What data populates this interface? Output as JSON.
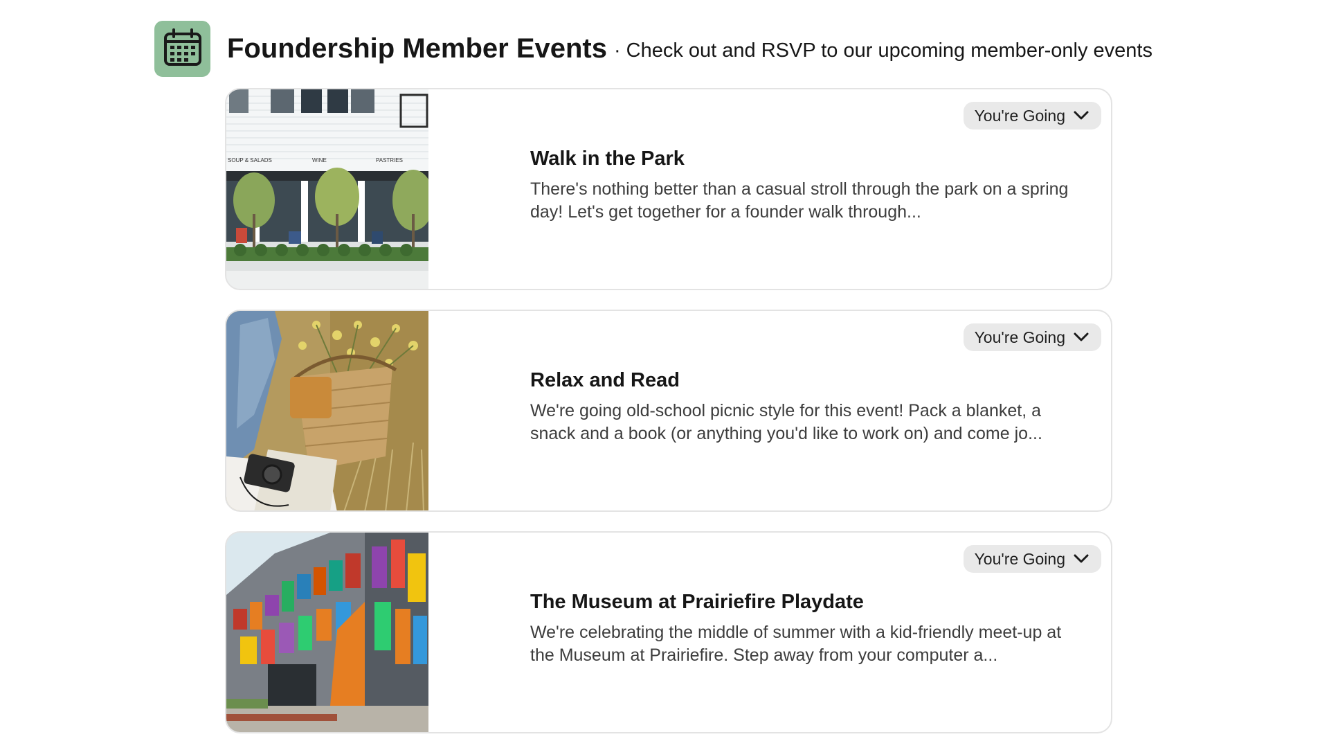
{
  "header": {
    "icon": "calendar-icon",
    "title": "Foundership Member Events",
    "separator": "·",
    "subtitle": "Check out and RSVP to our upcoming member-only events"
  },
  "events": [
    {
      "title": "Walk in the Park",
      "description": "There's nothing better than a casual stroll through the park on a spring day! Let's get together for a founder walk through...",
      "rsvp_label": "You're Going",
      "image": "storefront-photo",
      "sign_texts": [
        "SOUP & SALADS",
        "WINE",
        "PASTRIES"
      ]
    },
    {
      "title": "Relax and Read",
      "description": "We're going old-school picnic style for this event! Pack a blanket, a snack and a book (or anything you'd like to work on) and come jo...",
      "rsvp_label": "You're Going",
      "image": "picnic-basket-photo"
    },
    {
      "title": "The Museum at Prairiefire Playdate",
      "description": "We're celebrating the middle of summer with a kid-friendly meet-up at the Museum at Prairiefire. Step away from your computer a...",
      "rsvp_label": "You're Going",
      "image": "museum-photo"
    }
  ],
  "colors": {
    "icon_bg": "#8fbf9a",
    "pill_bg": "#e9e9e9",
    "card_border": "#e3e3e3"
  }
}
